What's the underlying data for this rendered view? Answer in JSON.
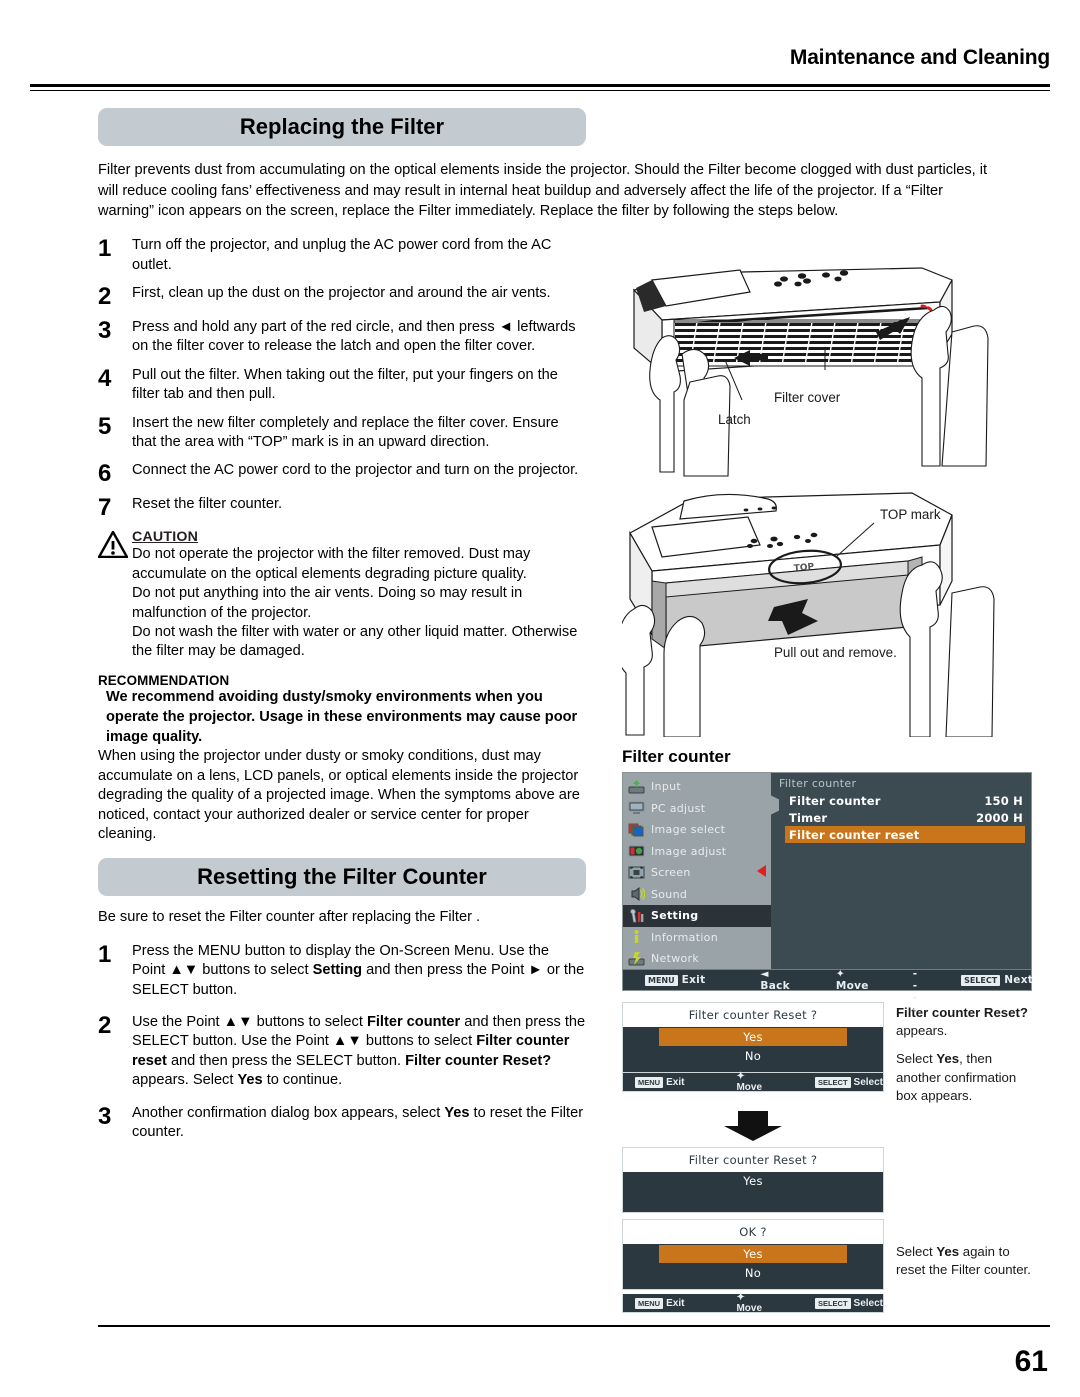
{
  "header": {
    "title": "Maintenance and Cleaning"
  },
  "section1": {
    "banner": "Replacing the Filter",
    "intro": "Filter prevents dust from accumulating on the optical elements inside the projector. Should the Filter  become clogged with dust particles, it will reduce cooling fans’ effectiveness and may result in internal heat buildup and adversely affect the life of the projector. If a “Filter warning” icon appears on the screen, replace the Filter immediately. Replace the filter by following the steps below.",
    "steps": [
      {
        "num": "1",
        "text": "Turn off the projector, and unplug the AC power cord from the AC outlet."
      },
      {
        "num": "2",
        "text": "First, clean up the dust on the projector and around the air vents."
      },
      {
        "num": "3",
        "text": "Press and hold any part of the red circle, and then press ◄ leftwards on the filter cover to release the latch and open the filter cover."
      },
      {
        "num": "4",
        "text": "Pull out the filter. When taking out the filter, put your fingers on the filter tab and then pull."
      },
      {
        "num": "5",
        "text": "Insert the new filter completely and replace the filter cover. Ensure that the area with “TOP” mark is in an upward direction."
      },
      {
        "num": "6",
        "text": "Connect the AC power cord to the projector and turn on the projector."
      },
      {
        "num": "7",
        "text": "Reset the filter counter."
      }
    ]
  },
  "caution": {
    "icon": "warning-triangle-icon",
    "title": "CAUTION",
    "lines": [
      "Do not operate the projector with the filter removed. Dust may accumulate on the optical elements degrading picture quality.",
      "Do not put anything into the air vents. Doing so may result in malfunction of the projector.",
      "Do not wash the filter with water or any other liquid matter. Otherwise the filter may be damaged."
    ]
  },
  "recommendation": {
    "title": "RECOMMENDATION",
    "bold": "We recommend avoiding dusty/smoky environments when you operate the projector. Usage in these environments may cause poor image quality.",
    "body": "When using the projector under dusty or smoky conditions, dust may accumulate on a lens, LCD panels, or optical elements inside the projector degrading the quality of a projected image. When the symptoms above are noticed, contact your authorized dealer or service center for proper cleaning."
  },
  "section2": {
    "banner": "Resetting the Filter Counter",
    "intro": "Be sure to reset the Filter counter after replacing the Filter .",
    "steps": [
      {
        "num": "1",
        "pre": "Press the MENU button to display the On-Screen Menu. Use the Point ▲▼ buttons to select ",
        "bold": "Setting",
        "post": " and then press the Point ► or the SELECT button."
      },
      {
        "num": "2",
        "text": "Use the Point ▲▼ buttons to select Filter counter and then press the SELECT button. Use the Point ▲▼ buttons to select Filter counter reset and then press the SELECT button. Filter counter Reset? appears. Select Yes to continue."
      },
      {
        "num": "3",
        "text": "Another confirmation dialog box appears, select Yes to reset the Filter counter."
      }
    ]
  },
  "illustration1": {
    "name": "projector-filter-cover-illustration",
    "labels": {
      "filter_cover": "Filter cover",
      "latch": "Latch"
    },
    "accent_color": "#e31a1a"
  },
  "illustration2": {
    "name": "projector-filter-removal-illustration",
    "labels": {
      "top_mark": "TOP mark",
      "pull_out": "Pull out and remove.",
      "mark_text": "TOP"
    }
  },
  "osd": {
    "heading": "Filter counter",
    "sidebar": [
      {
        "label": "Input",
        "icon": "input-icon",
        "selected": false
      },
      {
        "label": "PC adjust",
        "icon": "monitor-icon",
        "selected": false
      },
      {
        "label": "Image select",
        "icon": "image-select-icon",
        "selected": false
      },
      {
        "label": "Image adjust",
        "icon": "image-adjust-icon",
        "selected": false
      },
      {
        "label": "Screen",
        "icon": "screen-icon",
        "selected": false
      },
      {
        "label": "Sound",
        "icon": "speaker-icon",
        "selected": false
      },
      {
        "label": "Setting",
        "icon": "wrench-icon",
        "selected": true
      },
      {
        "label": "Information",
        "icon": "info-icon",
        "selected": false
      },
      {
        "label": "Network",
        "icon": "network-icon",
        "selected": false
      }
    ],
    "panel_title": "Filter counter",
    "rows": [
      {
        "label": "Filter counter",
        "value": "150 H",
        "highlighted": false
      },
      {
        "label": "Timer",
        "value": "2000 H",
        "highlighted": false
      },
      {
        "label": "Filter counter reset",
        "value": "",
        "highlighted": true
      }
    ],
    "footer": [
      {
        "key": "MENU",
        "label": "Exit"
      },
      {
        "key": "",
        "label": "◄ Back"
      },
      {
        "key": "",
        "label": "✦ Move"
      },
      {
        "key": "",
        "label": "▶ - - - - -"
      },
      {
        "key": "SELECT",
        "label": "Next"
      }
    ],
    "highlight_color": "#c8751b",
    "panel_color": "#3c4a52",
    "sidebar_color": "#9aa3a8"
  },
  "dialog1": {
    "question": "Filter counter  Reset ?",
    "options": [
      {
        "label": "Yes",
        "selected": true
      },
      {
        "label": "No",
        "selected": false
      }
    ],
    "footer": [
      {
        "key": "MENU",
        "label": "Exit"
      },
      {
        "key": "",
        "label": "✦ Move"
      },
      {
        "key": "SELECT",
        "label": "Select"
      }
    ]
  },
  "dialog2": {
    "question": "Filter counter  Reset ?",
    "options": [
      {
        "label": "Yes",
        "selected": false
      }
    ]
  },
  "dialog3": {
    "question": "OK ?",
    "options": [
      {
        "label": "Yes",
        "selected": true
      },
      {
        "label": "No",
        "selected": false
      }
    ],
    "footer": [
      {
        "key": "MENU",
        "label": "Exit"
      },
      {
        "key": "",
        "label": "✦ Move"
      },
      {
        "key": "SELECT",
        "label": "Select"
      }
    ]
  },
  "notes": {
    "note1_bold": "Filter counter Reset?",
    "note1_rest": " appears.",
    "note2_pre": "Select ",
    "note2_bold": "Yes",
    "note2_post": ", then another confirmation box appears.",
    "note3_pre": "Select ",
    "note3_bold": "Yes",
    "note3_post": " again to reset the Filter counter."
  },
  "footer": {
    "page_number": "61"
  }
}
